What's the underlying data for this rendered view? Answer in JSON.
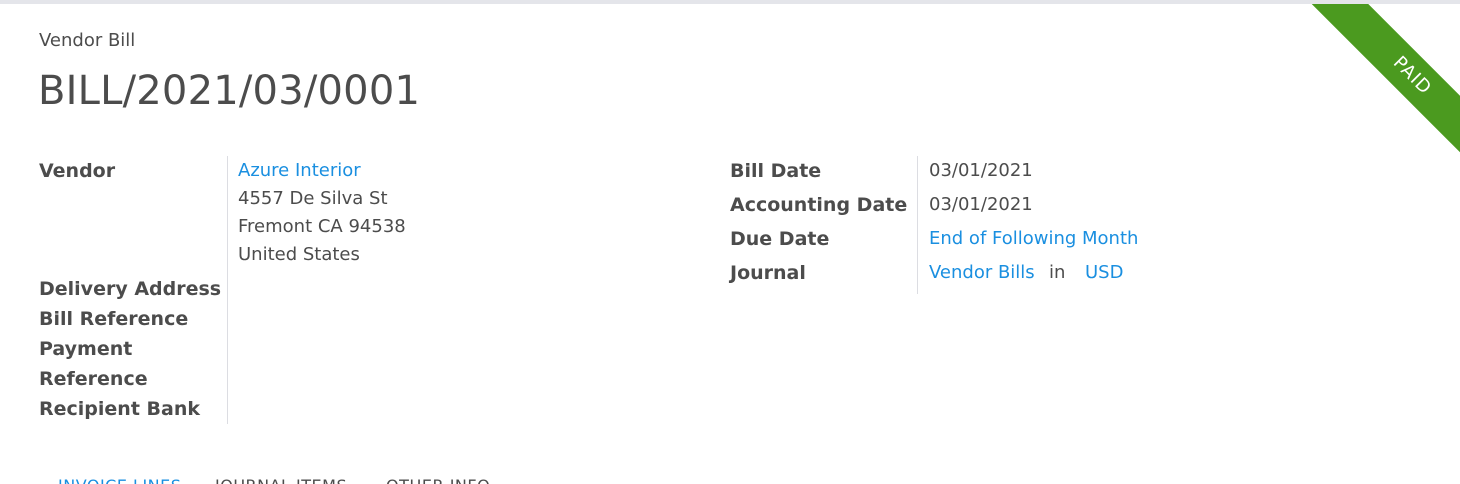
{
  "ribbon": {
    "label": "PAID",
    "color": "#4b9a1f"
  },
  "header": {
    "doc_type": "Vendor Bill",
    "doc_name": "BILL/2021/03/0001"
  },
  "left": {
    "vendor_label": "Vendor",
    "vendor_name": "Azure Interior",
    "address": [
      "4557 De Silva St",
      "Fremont CA 94538",
      "United States"
    ],
    "delivery_address_label": "Delivery Address",
    "bill_reference_label": "Bill Reference",
    "payment_reference_label": [
      "Payment",
      "Reference"
    ],
    "recipient_bank_label": "Recipient Bank"
  },
  "right": {
    "bill_date_label": "Bill Date",
    "bill_date": "03/01/2021",
    "accounting_date_label": "Accounting Date",
    "accounting_date": "03/01/2021",
    "due_date_label": "Due Date",
    "due_date": "End of Following Month",
    "journal_label": "Journal",
    "journal": "Vendor Bills",
    "in_text": "in",
    "currency": "USD"
  },
  "tabs": [
    {
      "label": "INVOICE LINES",
      "active": true
    },
    {
      "label": "JOURNAL ITEMS",
      "active": false
    },
    {
      "label": "OTHER INFO",
      "active": false
    }
  ],
  "colors": {
    "link": "#1a8fe0",
    "text": "#4c4c4c"
  }
}
